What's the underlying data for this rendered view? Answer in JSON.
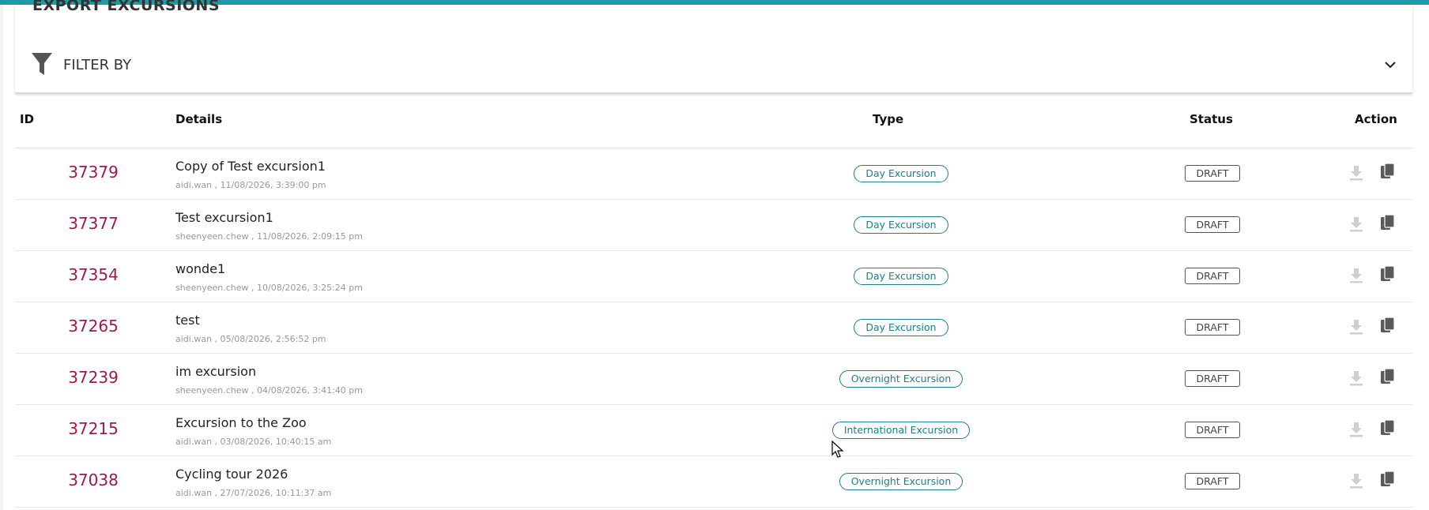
{
  "panel": {
    "title": "EXPORT EXCURSIONS",
    "filter_label": "FILTER BY"
  },
  "columns": [
    "ID",
    "Details",
    "Type",
    "Status",
    "Action"
  ],
  "rows": [
    {
      "id": "37379",
      "title": "Copy of Test excursion1",
      "meta": "aidi.wan , 11/08/2026, 3:39:00 pm",
      "type": "Day Excursion",
      "status": "DRAFT"
    },
    {
      "id": "37377",
      "title": "Test excursion1",
      "meta": "sheenyeen.chew , 11/08/2026, 2:09:15 pm",
      "type": "Day Excursion",
      "status": "DRAFT"
    },
    {
      "id": "37354",
      "title": "wonde1",
      "meta": "sheenyeen.chew , 10/08/2026, 3:25:24 pm",
      "type": "Day Excursion",
      "status": "DRAFT"
    },
    {
      "id": "37265",
      "title": "test",
      "meta": "aidi.wan , 05/08/2026, 2:56:52 pm",
      "type": "Day Excursion",
      "status": "DRAFT"
    },
    {
      "id": "37239",
      "title": "im excursion",
      "meta": "sheenyeen.chew , 04/08/2026, 3:41:40 pm",
      "type": "Overnight Excursion",
      "status": "DRAFT"
    },
    {
      "id": "37215",
      "title": "Excursion to the Zoo",
      "meta": "aidi.wan , 03/08/2026, 10:40:15 am",
      "type": "International Excursion",
      "status": "DRAFT"
    },
    {
      "id": "37038",
      "title": "Cycling tour 2026",
      "meta": "aidi.wan , 27/07/2026, 10:11:37 am",
      "type": "Overnight Excursion",
      "status": "DRAFT"
    }
  ],
  "colors": {
    "accent": "#1d9aa5",
    "id_text": "#9c1a50",
    "type_badge": "#1d7f88",
    "download_icon_disabled": "#cfcfcf",
    "copy_icon": "#5a5a5a"
  },
  "icons": {
    "filter": "funnel-icon",
    "expand": "chevron-down-icon",
    "download": "download-icon",
    "copy": "copy-icon"
  }
}
